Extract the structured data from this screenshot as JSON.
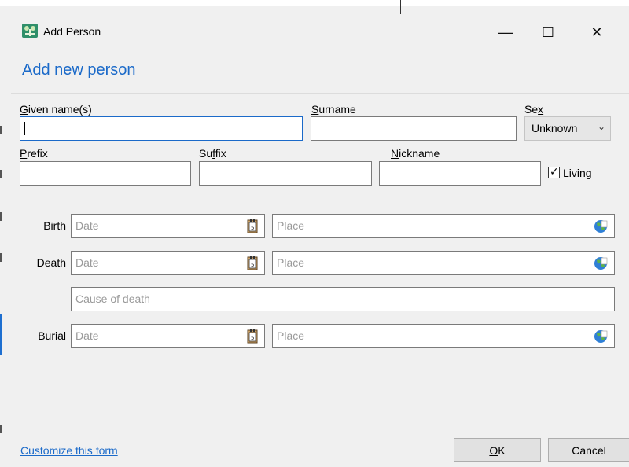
{
  "window": {
    "title": "Add Person",
    "minimize_glyph": "—",
    "maximize_glyph": "☐",
    "close_glyph": "✕",
    "icon": "family-tree-icon"
  },
  "heading": "Add new person",
  "fields": {
    "given_name": {
      "label_u": "G",
      "label_rest": "iven name(s)",
      "value": ""
    },
    "surname": {
      "label_u": "S",
      "label_rest": "urname",
      "value": ""
    },
    "sex": {
      "label_pre": "Se",
      "label_u": "x",
      "value": "Unknown"
    },
    "prefix": {
      "label_u": "P",
      "label_rest": "refix",
      "value": ""
    },
    "suffix": {
      "label_pre": "Su",
      "label_u": "f",
      "label_rest": "fix",
      "value": ""
    },
    "nickname": {
      "label_u": "N",
      "label_rest": "ickname",
      "value": ""
    },
    "living": {
      "label": "Living",
      "checked": true
    }
  },
  "events": {
    "birth": {
      "label": "Birth",
      "date_placeholder": "Date",
      "place_placeholder": "Place"
    },
    "death": {
      "label": "Death",
      "date_placeholder": "Date",
      "place_placeholder": "Place",
      "cause_placeholder": "Cause of death"
    },
    "burial": {
      "label": "Burial",
      "date_placeholder": "Date",
      "place_placeholder": "Place"
    }
  },
  "footer": {
    "customize_link": "Customize this form",
    "ok_u": "O",
    "ok_rest": "K",
    "cancel": "Cancel"
  },
  "colors": {
    "accent": "#1b6ac9",
    "background": "#f0f0f0"
  }
}
